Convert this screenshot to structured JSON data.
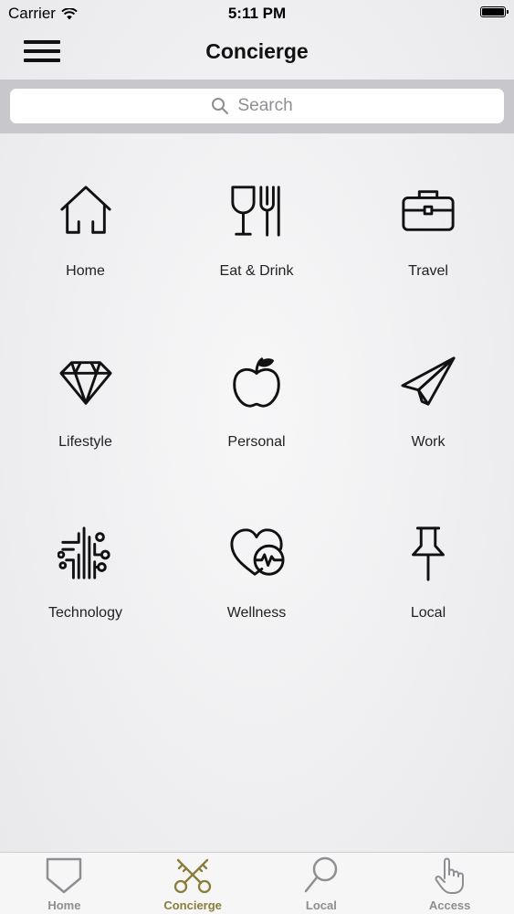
{
  "status_bar": {
    "carrier": "Carrier",
    "time": "5:11 PM",
    "battery_level": 1.0
  },
  "nav": {
    "title": "Concierge",
    "menu_icon": "hamburger-menu-icon"
  },
  "search": {
    "placeholder": "Search",
    "value": "",
    "icon": "search-icon"
  },
  "categories": [
    {
      "label": "Home",
      "icon": "house-icon"
    },
    {
      "label": "Eat & Drink",
      "icon": "glass-fork-icon"
    },
    {
      "label": "Travel",
      "icon": "briefcase-icon"
    },
    {
      "label": "Lifestyle",
      "icon": "diamond-icon"
    },
    {
      "label": "Personal",
      "icon": "apple-icon"
    },
    {
      "label": "Work",
      "icon": "paper-plane-icon"
    },
    {
      "label": "Technology",
      "icon": "circuit-icon"
    },
    {
      "label": "Wellness",
      "icon": "heart-pulse-icon"
    },
    {
      "label": "Local",
      "icon": "pushpin-icon"
    }
  ],
  "tab_bar": {
    "active_color": "#8a7d3a",
    "inactive_color": "#8e8e93",
    "tabs": [
      {
        "label": "Home",
        "icon": "shield-icon",
        "active": false
      },
      {
        "label": "Concierge",
        "icon": "crossed-keys-icon",
        "active": true
      },
      {
        "label": "Local",
        "icon": "magnifier-icon",
        "active": false
      },
      {
        "label": "Access",
        "icon": "pointing-hand-icon",
        "active": false
      }
    ]
  }
}
